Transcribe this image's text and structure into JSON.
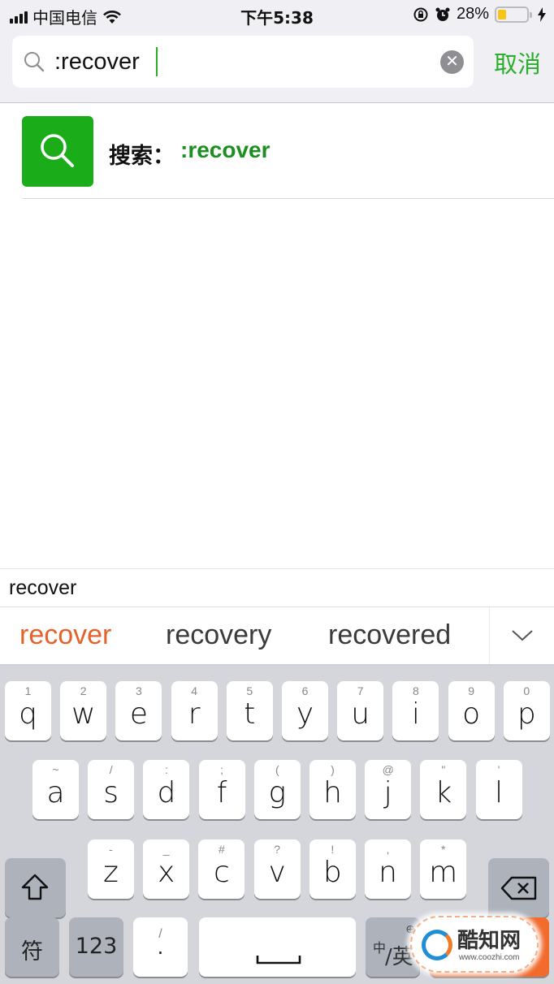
{
  "status_bar": {
    "carrier": "中国电信",
    "time": "下午5:38",
    "battery_percent_label": "28%",
    "battery_level": 0.28,
    "icons": [
      "signal-icon",
      "wifi-icon",
      "orientation-lock-icon",
      "alarm-icon",
      "battery-icon",
      "charging-icon"
    ]
  },
  "search": {
    "query": ":recover",
    "cancel_label": "取消",
    "accent_color": "#2aae2a"
  },
  "result": {
    "label": "搜索：",
    "query": ":recover",
    "icon_color": "#1aad19"
  },
  "ime": {
    "composing": "recover",
    "candidates": [
      "recover",
      "recovery",
      "recovered"
    ],
    "highlight_color": "#e5622a"
  },
  "keyboard": {
    "row1": [
      {
        "key": "q",
        "hint": "1"
      },
      {
        "key": "w",
        "hint": "2"
      },
      {
        "key": "e",
        "hint": "3"
      },
      {
        "key": "r",
        "hint": "4"
      },
      {
        "key": "t",
        "hint": "5"
      },
      {
        "key": "y",
        "hint": "6"
      },
      {
        "key": "u",
        "hint": "7"
      },
      {
        "key": "i",
        "hint": "8"
      },
      {
        "key": "o",
        "hint": "9"
      },
      {
        "key": "p",
        "hint": "0"
      }
    ],
    "row2": [
      {
        "key": "a",
        "hint": "~"
      },
      {
        "key": "s",
        "hint": "/"
      },
      {
        "key": "d",
        "hint": ":"
      },
      {
        "key": "f",
        "hint": ";"
      },
      {
        "key": "g",
        "hint": "("
      },
      {
        "key": "h",
        "hint": ")"
      },
      {
        "key": "j",
        "hint": "@"
      },
      {
        "key": "k",
        "hint": "\""
      },
      {
        "key": "l",
        "hint": "'"
      }
    ],
    "row3": [
      {
        "key": "z",
        "hint": "-"
      },
      {
        "key": "x",
        "hint": "_"
      },
      {
        "key": "c",
        "hint": "#"
      },
      {
        "key": "v",
        "hint": "?"
      },
      {
        "key": "b",
        "hint": "!"
      },
      {
        "key": "n",
        "hint": ","
      },
      {
        "key": "m",
        "hint": "*"
      }
    ],
    "symbols_label": "符",
    "numbers_label": "123",
    "punct_main": "·",
    "punct_hint": "/",
    "space_label": "␣",
    "lang_label": "中/英",
    "lang_small": "中",
    "lang_big": "/英"
  },
  "watermark": {
    "title": "酷知网",
    "url": "www.coozhi.com"
  }
}
